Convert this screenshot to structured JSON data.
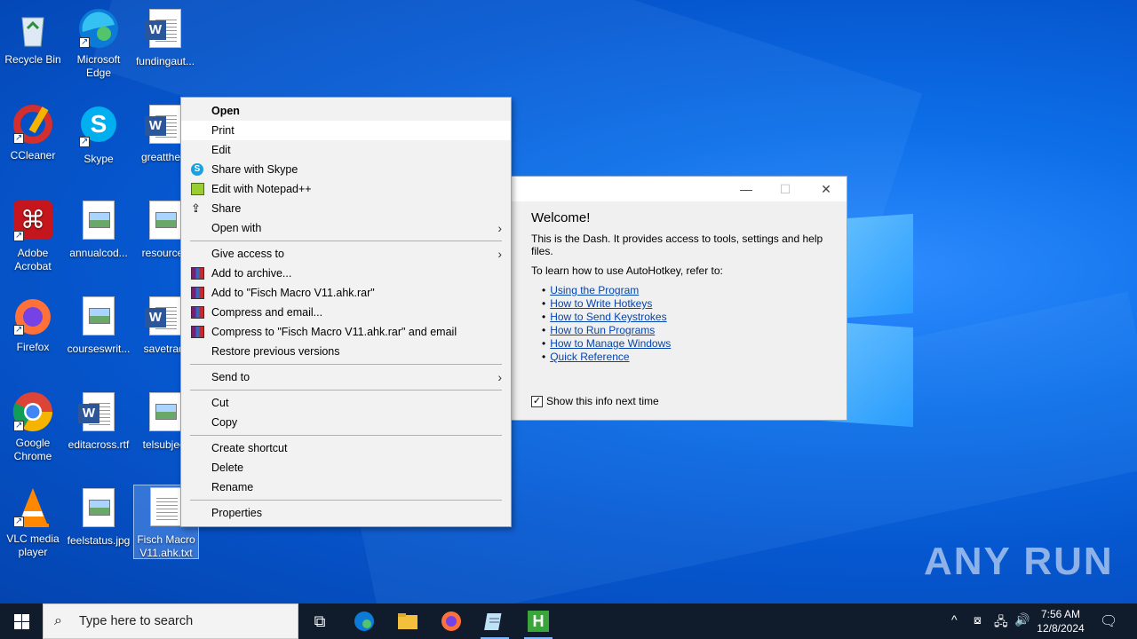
{
  "desktop": {
    "icons": [
      {
        "label": "Recycle Bin"
      },
      {
        "label": "Microsoft Edge"
      },
      {
        "label": "fundingaut..."
      },
      {
        "label": "CCleaner"
      },
      {
        "label": "Skype"
      },
      {
        "label": "greatthem"
      },
      {
        "label": "Adobe Acrobat"
      },
      {
        "label": "annualcod..."
      },
      {
        "label": "resources"
      },
      {
        "label": "Firefox"
      },
      {
        "label": "courseswrit..."
      },
      {
        "label": "savetradi"
      },
      {
        "label": "Google Chrome"
      },
      {
        "label": "editacross.rtf"
      },
      {
        "label": "telsubject"
      },
      {
        "label": "VLC media player"
      },
      {
        "label": "feelstatus.jpg"
      },
      {
        "label": "Fisch Macro V11.ahk.txt"
      }
    ]
  },
  "context_menu": {
    "items": [
      {
        "label": "Open"
      },
      {
        "label": "Print"
      },
      {
        "label": "Edit"
      },
      {
        "label": "Share with Skype"
      },
      {
        "label": "Edit with Notepad++"
      },
      {
        "label": "Share"
      },
      {
        "label": "Open with"
      },
      {
        "label": "Give access to"
      },
      {
        "label": "Add to archive..."
      },
      {
        "label": "Add to \"Fisch Macro V11.ahk.rar\""
      },
      {
        "label": "Compress and email..."
      },
      {
        "label": "Compress to \"Fisch Macro V11.ahk.rar\" and email"
      },
      {
        "label": "Restore previous versions"
      },
      {
        "label": "Send to"
      },
      {
        "label": "Cut"
      },
      {
        "label": "Copy"
      },
      {
        "label": "Create shortcut"
      },
      {
        "label": "Delete"
      },
      {
        "label": "Rename"
      },
      {
        "label": "Properties"
      }
    ]
  },
  "dash_window": {
    "heading": "Welcome!",
    "intro": "This is the Dash. It provides access to tools, settings and help files.",
    "learn": "To learn how to use AutoHotkey, refer to:",
    "links": [
      "Using the Program",
      "How to Write Hotkeys",
      "How to Send Keystrokes",
      "How to Run Programs",
      "How to Manage Windows",
      "Quick Reference"
    ],
    "checkbox_label": "Show this info next time",
    "checkbox_checked": true
  },
  "taskbar": {
    "search_placeholder": "Type here to search",
    "time": "7:56 AM",
    "date": "12/8/2024"
  },
  "watermark": "ANY RUN"
}
